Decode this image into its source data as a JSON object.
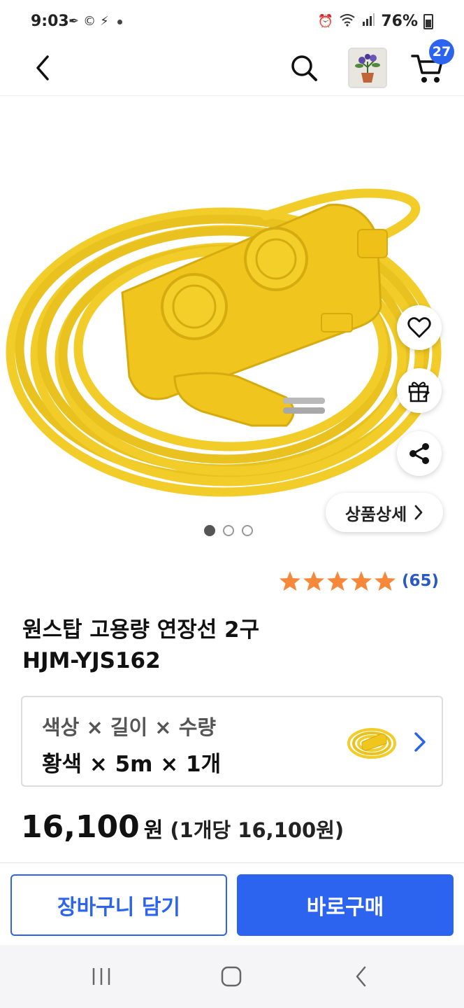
{
  "status_bar": {
    "time": "9:03",
    "battery": "76%"
  },
  "header": {
    "cart_count": "27"
  },
  "gallery": {
    "detail_button": "상품상세",
    "page_count": 3,
    "active_page": 1
  },
  "rating": {
    "stars": 5,
    "review_count": "(65)"
  },
  "product": {
    "title_line1": "원스탑 고용량 연장선 2구",
    "title_line2": "HJM-YJS162"
  },
  "option": {
    "label": "색상 × 길이 × 수량",
    "value": "황색 × 5m × 1개"
  },
  "price": {
    "amount": "16,100",
    "unit": "원",
    "per_unit": "(1개당 16,100원)"
  },
  "actions": {
    "add_to_cart": "장바구니 담기",
    "buy_now": "바로구매"
  },
  "colors": {
    "accent": "#2c64f0",
    "star": "#f7883a",
    "product_yellow": "#f5d22a"
  }
}
